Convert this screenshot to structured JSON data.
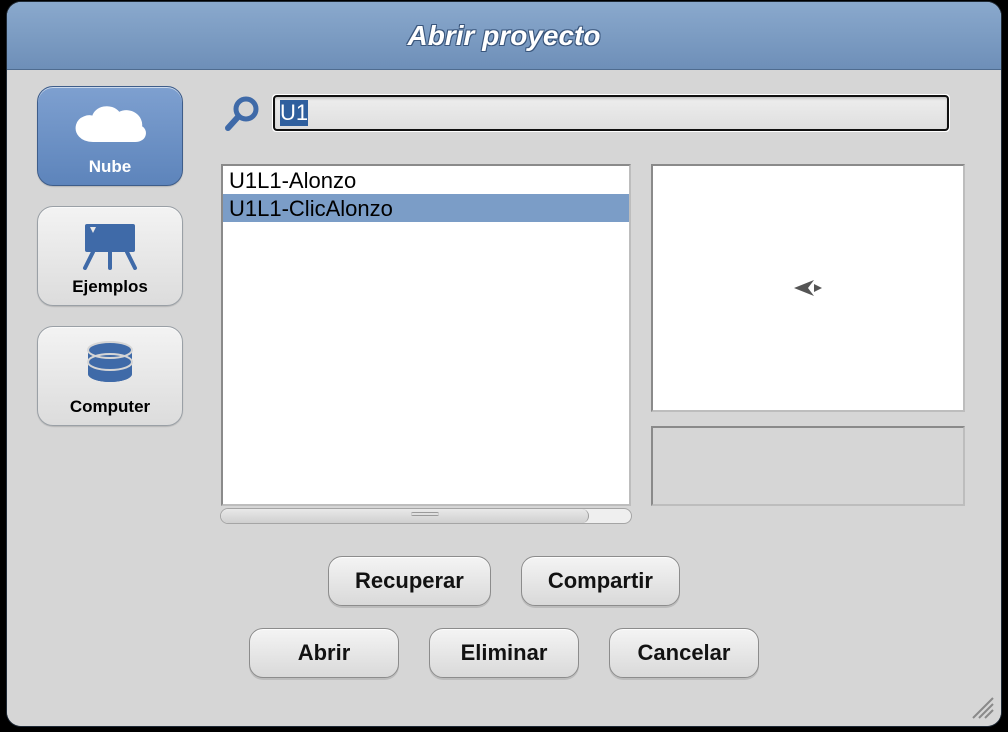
{
  "dialog": {
    "title": "Abrir proyecto"
  },
  "search": {
    "value": "U1"
  },
  "tabs": [
    {
      "id": "cloud",
      "label": "Nube",
      "icon": "cloud-icon",
      "active": true
    },
    {
      "id": "examples",
      "label": "Ejemplos",
      "icon": "easel-icon",
      "active": false
    },
    {
      "id": "computer",
      "label": "Computer",
      "icon": "disk-icon",
      "active": false
    }
  ],
  "list": {
    "items": [
      {
        "name": "U1L1-Alonzo",
        "selected": false
      },
      {
        "name": "U1L1-ClicAlonzo",
        "selected": true
      }
    ]
  },
  "buttons": {
    "recover": "Recuperar",
    "share": "Compartir",
    "open": "Abrir",
    "delete": "Eliminar",
    "cancel": "Cancelar"
  }
}
